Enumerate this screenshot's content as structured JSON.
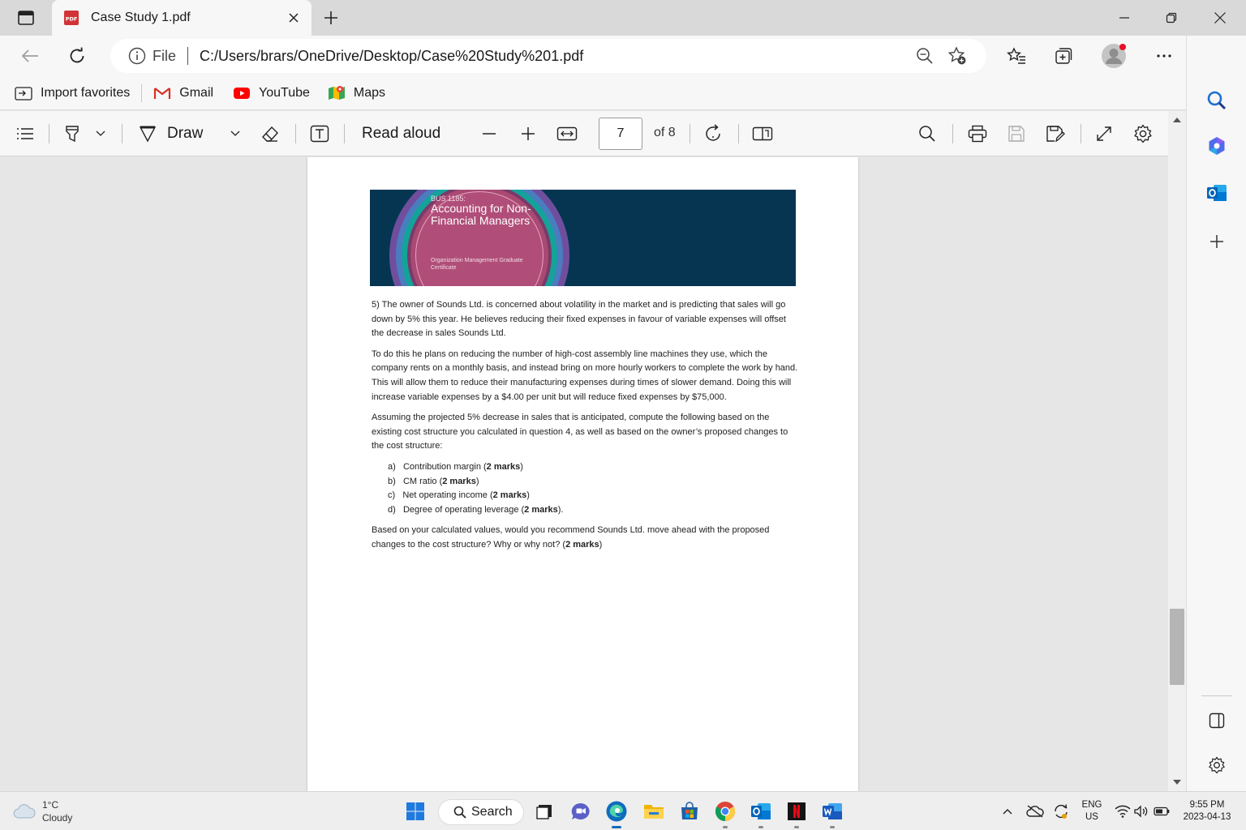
{
  "tab": {
    "title": "Case Study 1.pdf",
    "badge": "PDF"
  },
  "address": {
    "file_label": "File",
    "url": "C:/Users/brars/OneDrive/Desktop/Case%20Study%201.pdf"
  },
  "favorites": [
    {
      "label": "Import favorites",
      "icon": "import-favorites-icon"
    },
    {
      "label": "Gmail",
      "icon": "gmail-icon"
    },
    {
      "label": "YouTube",
      "icon": "youtube-icon"
    },
    {
      "label": "Maps",
      "icon": "maps-icon"
    }
  ],
  "pdf_toolbar": {
    "draw_label": "Draw",
    "read_aloud_label": "Read aloud",
    "page_current": "7",
    "page_of": "of 8"
  },
  "banner": {
    "code": "BUS 1185:",
    "course": "Accounting for Non-Financial Managers",
    "org": "Organization Management Graduate Certificate"
  },
  "document": {
    "p1": "5) The owner of Sounds Ltd. is concerned about volatility in the market and is predicting that sales will go down by 5% this year. He believes reducing their fixed expenses in favour of variable expenses will offset the decrease in sales Sounds Ltd.",
    "p2": "To do this he plans on reducing the number of high-cost assembly line machines they use, which the company rents on a monthly basis, and instead bring on more hourly workers to complete the work by hand. This will allow them to reduce their manufacturing expenses during times of slower demand.  Doing this will increase variable expenses by a $4.00 per unit but will reduce fixed expenses by $75,000.",
    "p3": "Assuming the projected 5% decrease in sales that is anticipated, compute the following based on the existing cost structure you calculated in question 4, as well as based on the owner’s proposed changes to the cost structure:",
    "items": [
      {
        "marker": "a)",
        "text": "Contribution margin (",
        "bold": "2 marks",
        "end": ")"
      },
      {
        "marker": "b)",
        "text": "CM ratio (",
        "bold": "2 marks",
        "end": ")"
      },
      {
        "marker": "c)",
        "text": "Net operating income (",
        "bold": "2 marks",
        "end": ")"
      },
      {
        "marker": "d)",
        "text": "Degree of operating leverage (",
        "bold": "2 marks",
        "end": ")."
      }
    ],
    "p4": "Based on your calculated values, would you recommend Sounds Ltd. move ahead with the proposed changes to the cost structure? Why or why not? (",
    "p4_bold": "2 marks",
    "p4_end": ")"
  },
  "taskbar": {
    "weather_temp": "1°C",
    "weather_desc": "Cloudy",
    "search_label": "Search",
    "lang_top": "ENG",
    "lang_bottom": "US",
    "time": "9:55 PM",
    "date": "2023-04-13"
  },
  "colors": {
    "banner_bg": "#063552",
    "banner_ring_inner": "#a94a73",
    "edge_blue": "#0c59a4",
    "chrome_bg": "#f7f7f7",
    "tabstrip_bg": "#d9d9d9"
  }
}
